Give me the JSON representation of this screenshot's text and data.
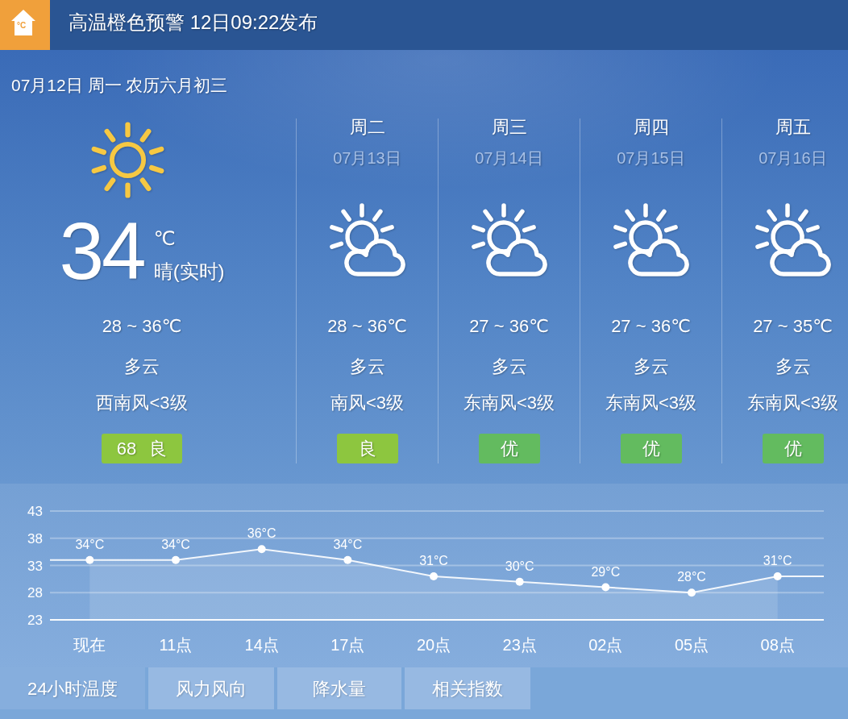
{
  "alert": {
    "logo_text": "°C",
    "title": "高温橙色预警 12日09:22发布"
  },
  "today": {
    "date": "07月12日 周一 农历六月初三",
    "kind": "sunny",
    "temperature": "34",
    "unit": "℃",
    "now_condition": "晴(实时)",
    "range": "28 ~ 36℃",
    "condition": "多云",
    "wind": "西南风<3级",
    "aqi": {
      "text": "68 良",
      "color": "#8dc63f"
    }
  },
  "forecast": [
    {
      "day": "周二",
      "date": "07月13日",
      "kind": "partly_cloudy",
      "range": "28 ~ 36℃",
      "condition": "多云",
      "wind": "南风<3级",
      "aqi": {
        "text": "良",
        "color": "#8dc63f"
      }
    },
    {
      "day": "周三",
      "date": "07月14日",
      "kind": "partly_cloudy",
      "range": "27 ~ 36℃",
      "condition": "多云",
      "wind": "东南风<3级",
      "aqi": {
        "text": "优",
        "color": "#63bb5f"
      }
    },
    {
      "day": "周四",
      "date": "07月15日",
      "kind": "partly_cloudy",
      "range": "27 ~ 36℃",
      "condition": "多云",
      "wind": "东南风<3级",
      "aqi": {
        "text": "优",
        "color": "#63bb5f"
      }
    },
    {
      "day": "周五",
      "date": "07月16日",
      "kind": "partly_cloudy",
      "range": "27 ~ 35℃",
      "condition": "多云",
      "wind": "东南风<3级",
      "aqi": {
        "text": "优",
        "color": "#63bb5f"
      }
    }
  ],
  "hourly": {
    "chart_data": {
      "type": "area",
      "categories": [
        "现在",
        "11点",
        "14点",
        "17点",
        "20点",
        "23点",
        "02点",
        "05点",
        "08点"
      ],
      "series": [
        {
          "color": "#ffffff",
          "values": [
            34,
            34,
            36,
            34,
            31,
            30,
            29,
            28,
            31
          ]
        }
      ],
      "ylim": [
        23,
        43
      ],
      "yticks": [
        23,
        28,
        33,
        38,
        43
      ],
      "grid": true,
      "value_labels": [
        "34°C",
        "34°C",
        "36°C",
        "34°C",
        "31°C",
        "30°C",
        "29°C",
        "28°C",
        "31°C"
      ]
    }
  },
  "tabs": [
    {
      "label": "24小时温度",
      "selected": true
    },
    {
      "label": "风力风向",
      "selected": false
    },
    {
      "label": "降水量",
      "selected": false
    },
    {
      "label": "相关指数",
      "selected": false
    }
  ]
}
